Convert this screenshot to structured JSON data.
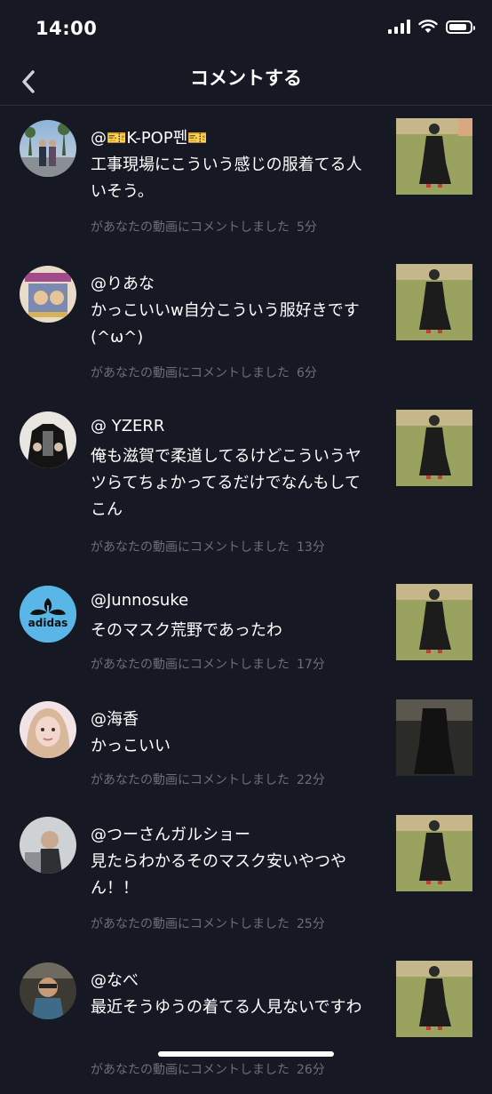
{
  "status": {
    "time": "14:00",
    "battery_level": 0.85
  },
  "header": {
    "title": "コメントする",
    "back_icon": "chevron-left-icon"
  },
  "colors": {
    "background": "#161823",
    "text": "#ffffff",
    "meta": "#6d6e77",
    "divider": "#2b2d38"
  },
  "notifications": [
    {
      "username": "@🎫K-POP펜🎫",
      "comment": "工事現場にこういう感じの服着てる人いそう。",
      "meta": "があなたの動画にコメントしました",
      "time": "5分",
      "avatar": "avatar-photo"
    },
    {
      "username": "@りあな",
      "comment": "かっこいいw自分こういう服好きです(^ω^)",
      "meta": "があなたの動画にコメントしました",
      "time": "6分",
      "avatar": "avatar-photo"
    },
    {
      "username": "@ YZERR",
      "comment": "俺も滋賀で柔道してるけどこういうヤツらてちょかってるだけでなんもしてこん",
      "meta": "があなたの動画にコメントしました",
      "time": "13分",
      "avatar": "avatar-photo"
    },
    {
      "username": "@Junnosuke",
      "comment": "そのマスク荒野であったわ",
      "meta": "があなたの動画にコメントしました",
      "time": "17分",
      "avatar": "adidas-logo",
      "logo_text": "adidas"
    },
    {
      "username": "@海香",
      "comment": "かっこいい",
      "meta": "があなたの動画にコメントしました",
      "time": "22分",
      "avatar": "avatar-photo"
    },
    {
      "username": "@つーさんガルショー",
      "comment": "見たらわかるそのマスク安いやつやん！！",
      "meta": "があなたの動画にコメントしました",
      "time": "25分",
      "avatar": "avatar-photo"
    },
    {
      "username": "@なべ",
      "comment": "最近そうゆうの着てる人見ないですわ",
      "meta": "があなたの動画にコメントしました",
      "time": "26分",
      "avatar": "avatar-photo"
    }
  ]
}
